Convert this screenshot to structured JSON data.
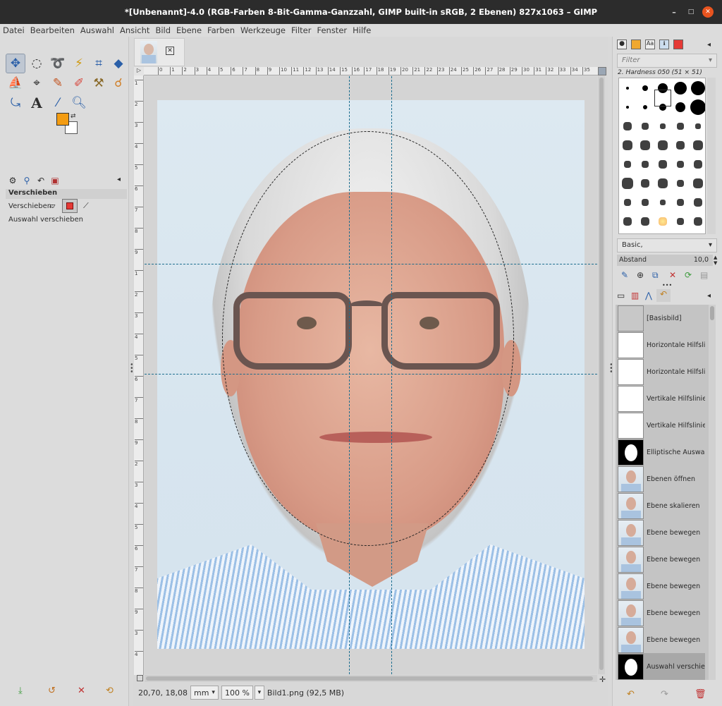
{
  "window": {
    "title": "*[Unbenannt]-4.0 (RGB-Farben 8-Bit-Gamma-Ganzzahl, GIMP built-in sRGB, 2 Ebenen) 827x1063 – GIMP",
    "minimize": "–",
    "maximize": "□",
    "close": "✕"
  },
  "menu": [
    "Datei",
    "Bearbeiten",
    "Auswahl",
    "Ansicht",
    "Bild",
    "Ebene",
    "Farben",
    "Werkzeuge",
    "Filter",
    "Fenster",
    "Hilfe"
  ],
  "colors": {
    "foreground": "#f39c12",
    "background": "#ffffff",
    "guide": "#1d6e8f",
    "accent_red": "#e53935"
  },
  "tool_options": {
    "title": "Verschieben",
    "move_label": "Verschieben:",
    "mode_hint": "Auswahl verschieben"
  },
  "ruler": {
    "h_labels": [
      "0",
      "1",
      "2",
      "3",
      "4",
      "5",
      "6",
      "7",
      "8",
      "9",
      "10",
      "11",
      "12",
      "13",
      "14",
      "15",
      "16",
      "17",
      "18",
      "19",
      "20",
      "21",
      "22",
      "23",
      "24",
      "25",
      "26",
      "27",
      "28",
      "29",
      "30",
      "31",
      "32",
      "33",
      "34",
      "35"
    ],
    "v_labels": [
      "1",
      "2",
      "3",
      "4",
      "5",
      "6",
      "7",
      "8",
      "9",
      "1",
      "2",
      "3",
      "4",
      "5",
      "6",
      "7",
      "8",
      "9",
      "2",
      "3",
      "4",
      "5",
      "6",
      "7",
      "8",
      "9",
      "3",
      "4"
    ]
  },
  "status": {
    "coords": "20,70, 18,08",
    "unit": "mm",
    "zoom": "100 %",
    "info": "Bild1.png (92,5 MB)"
  },
  "brushes": {
    "filter_placeholder": "Filter",
    "selected": "2. Hardness 050 (51 × 51)",
    "preset": "Basic,",
    "spacing_label": "Abstand",
    "spacing_value": "10,0"
  },
  "history": [
    {
      "label": "[Basisbild]",
      "thumb": "blank-gray"
    },
    {
      "label": "Horizontale Hilfslinie",
      "thumb": "white"
    },
    {
      "label": "Horizontale Hilfslinie",
      "thumb": "white"
    },
    {
      "label": "Vertikale Hilfslinie hi",
      "thumb": "white"
    },
    {
      "label": "Vertikale Hilfslinie hi",
      "thumb": "white"
    },
    {
      "label": "Elliptische Auswahl",
      "thumb": "ellipse-mask"
    },
    {
      "label": "Ebenen öffnen",
      "thumb": "photo"
    },
    {
      "label": "Ebene skalieren",
      "thumb": "photo"
    },
    {
      "label": "Ebene bewegen",
      "thumb": "photo"
    },
    {
      "label": "Ebene bewegen",
      "thumb": "photo"
    },
    {
      "label": "Ebene bewegen",
      "thumb": "photo"
    },
    {
      "label": "Ebene bewegen",
      "thumb": "photo"
    },
    {
      "label": "Ebene bewegen",
      "thumb": "photo"
    },
    {
      "label": "Auswahl verschieben",
      "thumb": "ellipse-mask"
    }
  ]
}
